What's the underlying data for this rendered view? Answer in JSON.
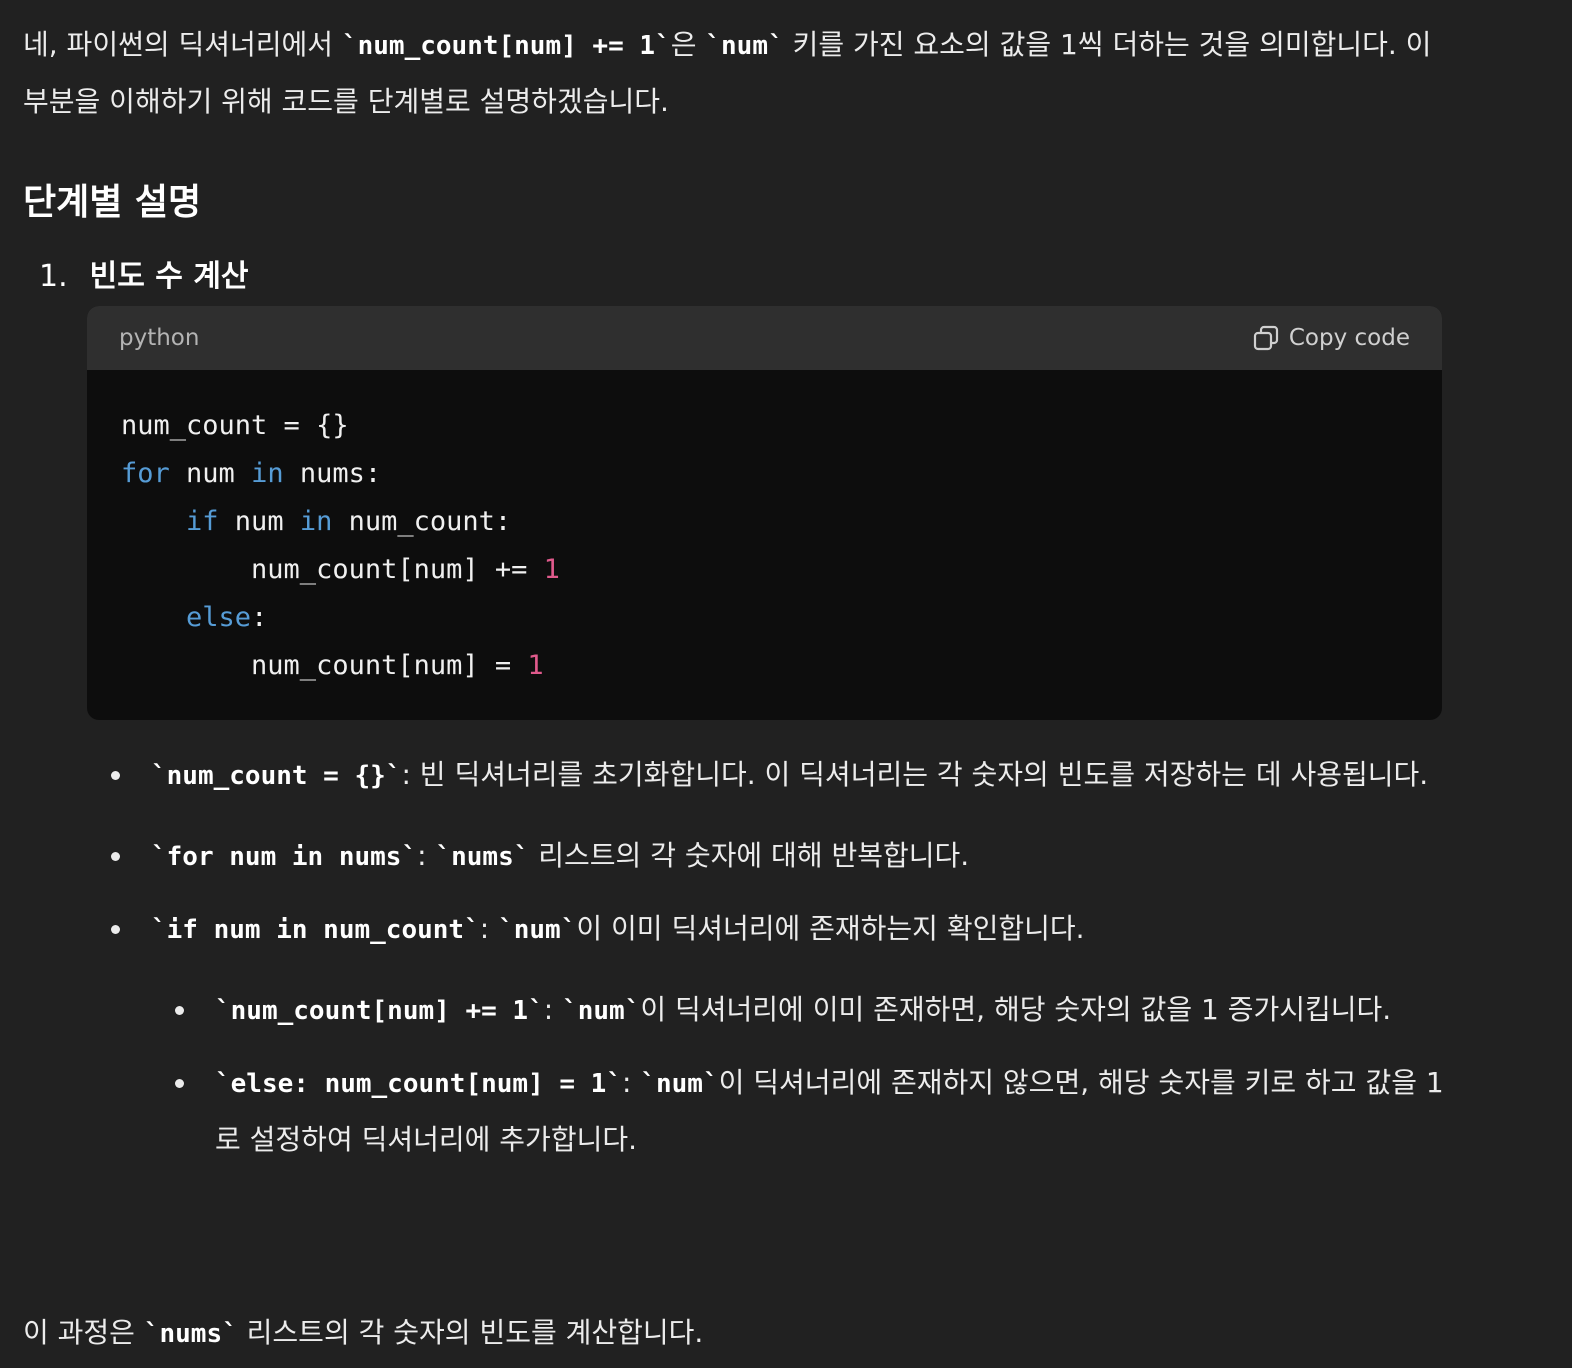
{
  "intro": {
    "t1": "네, 파이썬의 딕셔너리에서 ",
    "c1": "`num_count[num] += 1`",
    "t2": "은 ",
    "c2": "`num`",
    "t3": " 키를 가진 요소의 값을 1씩 더하는 것을 의미합니다. 이 부분을 이해하기 위해 코드를 단계별로 설명하겠습니다."
  },
  "section_heading": "단계별 설명",
  "step": {
    "number": "1.",
    "title": "빈도 수 계산"
  },
  "codeblock": {
    "language": "python",
    "copy_label": "Copy code",
    "lines": {
      "l1": "num_count = {}",
      "l2_kw1": "for",
      "l2_a": " num ",
      "l2_kw2": "in",
      "l2_b": " nums:",
      "l3_indent": "    ",
      "l3_kw1": "if",
      "l3_a": " num ",
      "l3_kw2": "in",
      "l3_b": " num_count:",
      "l4_a": "        num_count[num] += ",
      "l4_num": "1",
      "l5_indent": "    ",
      "l5_kw": "else",
      "l5_b": ":",
      "l6_a": "        num_count[num] = ",
      "l6_num": "1"
    }
  },
  "bullets": [
    {
      "code": "`num_count = {}`",
      "text": ": 빈 딕셔너리를 초기화합니다. 이 딕셔너리는 각 숫자의 빈도를 저장하는 데 사용됩니다."
    },
    {
      "code": "`for num in nums`",
      "mid": ": ",
      "code2": "`nums`",
      "text": " 리스트의 각 숫자에 대해 반복합니다."
    },
    {
      "code": "`if num in num_count`",
      "mid": ": ",
      "code2": "`num`",
      "text": "이 이미 딕셔너리에 존재하는지 확인합니다."
    },
    {
      "code": "`num_count[num] += 1`",
      "mid": ": ",
      "code2": "`num`",
      "text": "이 딕셔너리에 이미 존재하면, 해당 숫자의 값을 1 증가시킵니다."
    },
    {
      "code": "`else: num_count[num] = 1`",
      "mid": ": ",
      "code2": "`num`",
      "text": "이 딕셔너리에 존재하지 않으면, 해당 숫자를 키로 하고 값을 1로 설정하여 딕셔너리에 추가합니다."
    }
  ],
  "closing": {
    "t1": "이 과정은 ",
    "c1": "`nums`",
    "t2": " 리스트의 각 숫자의 빈도를 계산합니다."
  }
}
